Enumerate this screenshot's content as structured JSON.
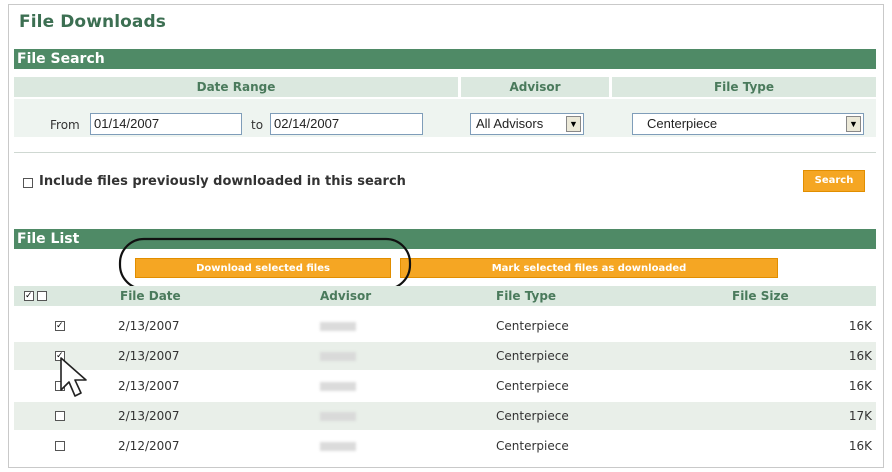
{
  "page_title": "File Downloads",
  "search": {
    "section_title": "File Search",
    "date_range_header": "Date Range",
    "advisor_header": "Advisor",
    "file_type_header": "File Type",
    "from_label": "From",
    "from_value": "01/14/2007",
    "to_label": "to",
    "to_value": "02/14/2007",
    "advisor_value": "All Advisors",
    "file_type_value": "Centerpiece",
    "include_label": "Include files previously downloaded in this search",
    "include_checked": false,
    "search_button": "Search"
  },
  "file_list": {
    "section_title": "File List",
    "download_button": "Download selected files",
    "mark_button": "Mark selected files as downloaded",
    "columns": {
      "date": "File Date",
      "advisor": "Advisor",
      "type": "File Type",
      "size": "File Size"
    },
    "rows": [
      {
        "date": "2/13/2007",
        "type": "Centerpiece",
        "size": "16K",
        "checked": true
      },
      {
        "date": "2/13/2007",
        "type": "Centerpiece",
        "size": "16K",
        "checked": true
      },
      {
        "date": "2/13/2007",
        "type": "Centerpiece",
        "size": "16K",
        "checked": false
      },
      {
        "date": "2/13/2007",
        "type": "Centerpiece",
        "size": "17K",
        "checked": false
      },
      {
        "date": "2/12/2007",
        "type": "Centerpiece",
        "size": "16K",
        "checked": false
      }
    ]
  },
  "colors": {
    "green_bar": "#4f8a66",
    "title_green": "#3c6f52",
    "orange": "#f5a623"
  }
}
